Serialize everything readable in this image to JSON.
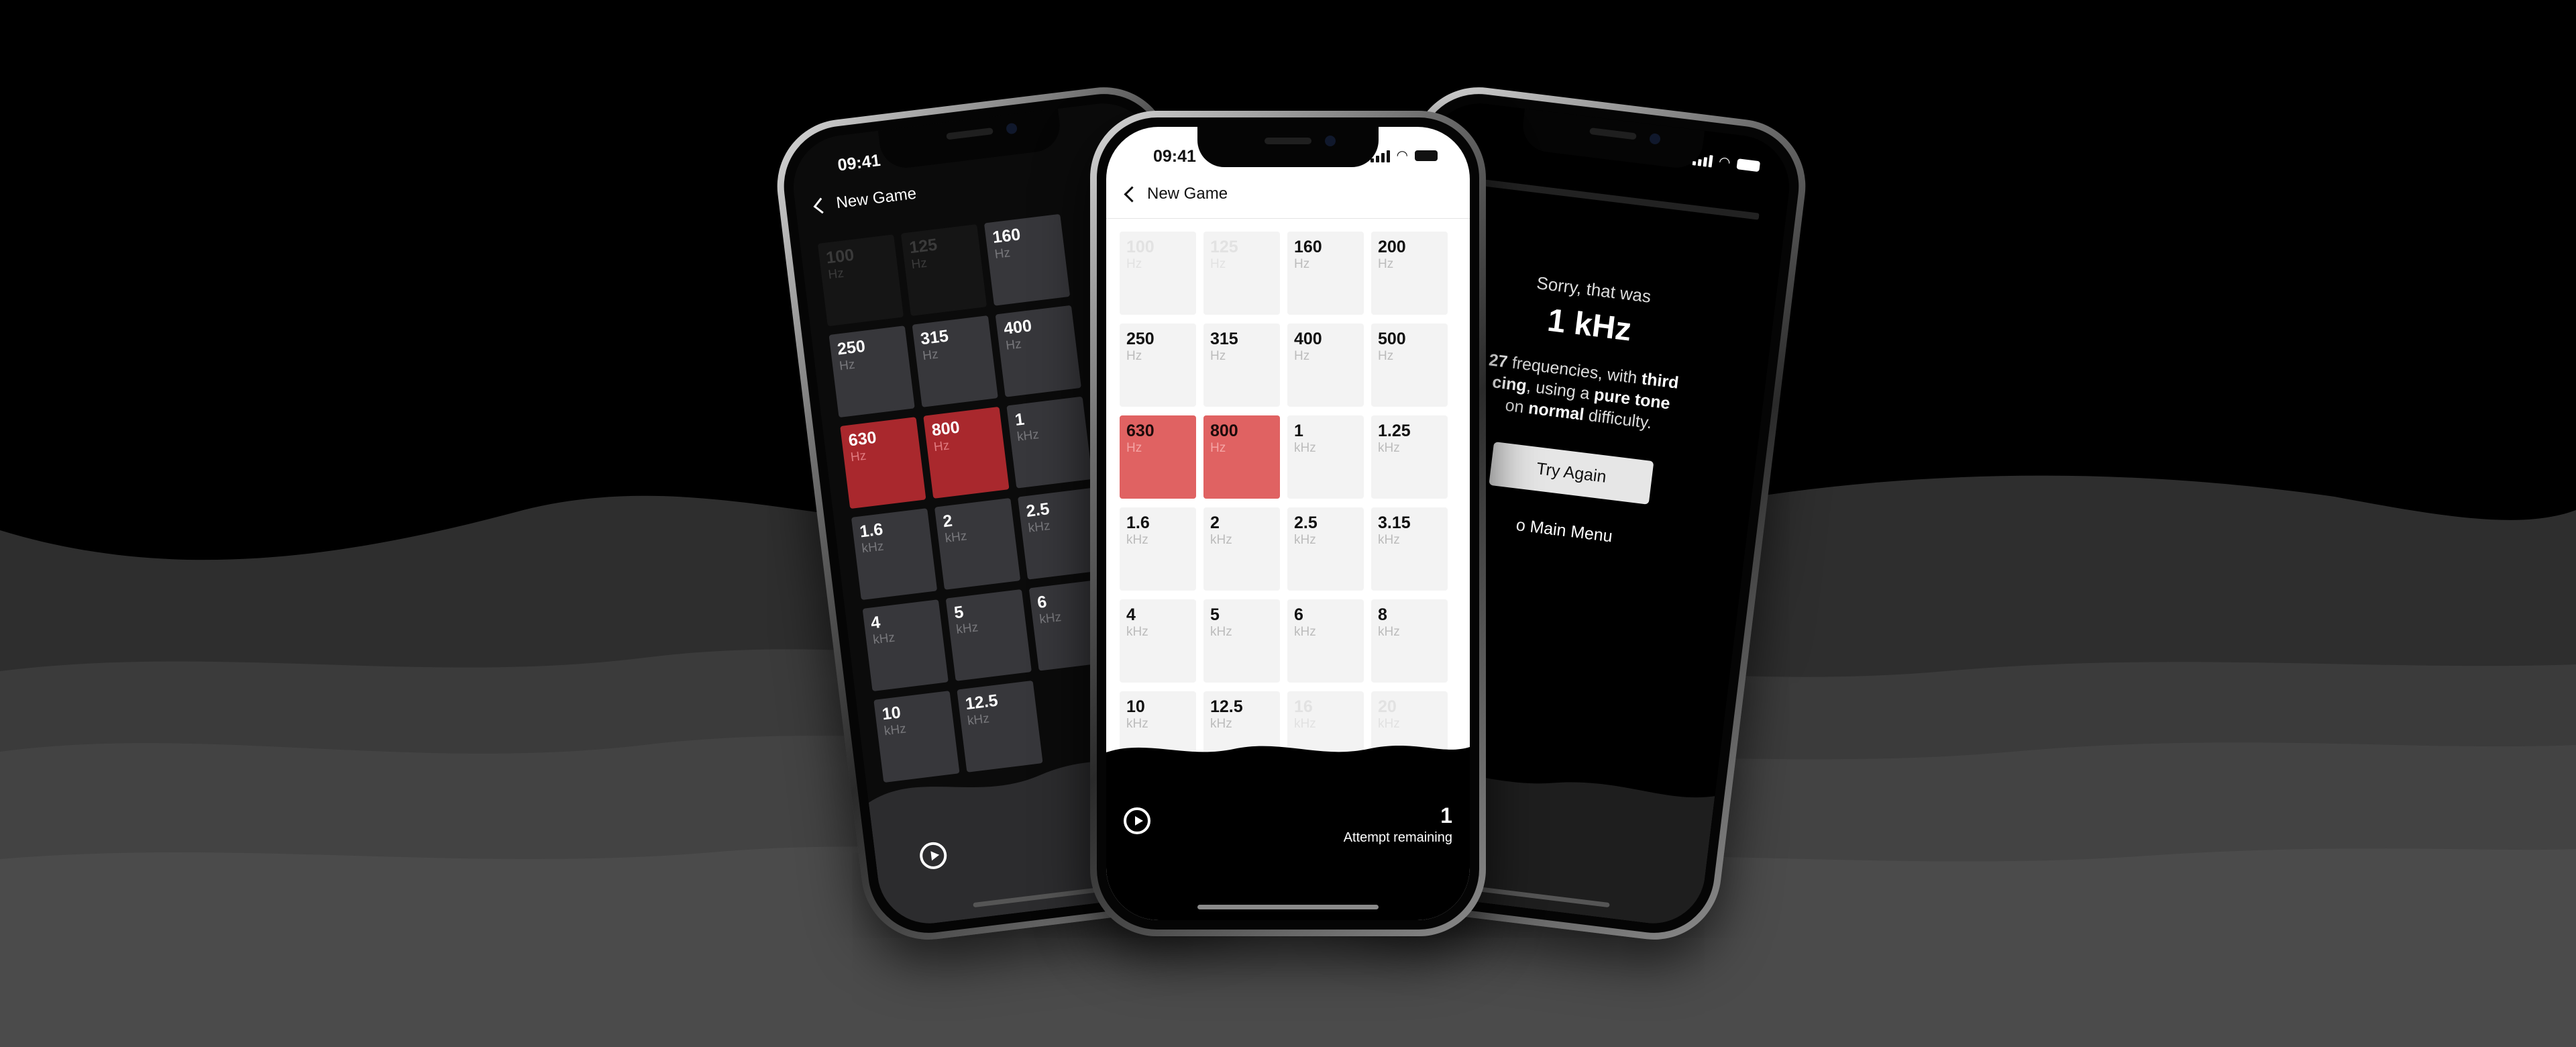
{
  "colors": {
    "bg_top": "#000000",
    "wave1": "#2e2e2e",
    "wave2": "#3e3e3e",
    "wave3": "#4a4a4a",
    "selected_light": "#e06262",
    "selected_dark": "#a9282d"
  },
  "status": {
    "time": "09:41"
  },
  "nav": {
    "back_label": "New Game"
  },
  "center_tiles": [
    {
      "v": "100",
      "u": "Hz",
      "state": "dim"
    },
    {
      "v": "125",
      "u": "Hz",
      "state": "dim"
    },
    {
      "v": "160",
      "u": "Hz",
      "state": "on"
    },
    {
      "v": "200",
      "u": "Hz",
      "state": "on"
    },
    {
      "v": "250",
      "u": "Hz",
      "state": "on"
    },
    {
      "v": "315",
      "u": "Hz",
      "state": "on"
    },
    {
      "v": "400",
      "u": "Hz",
      "state": "on"
    },
    {
      "v": "500",
      "u": "Hz",
      "state": "on"
    },
    {
      "v": "630",
      "u": "Hz",
      "state": "sel"
    },
    {
      "v": "800",
      "u": "Hz",
      "state": "sel"
    },
    {
      "v": "1",
      "u": "kHz",
      "state": "on"
    },
    {
      "v": "1.25",
      "u": "kHz",
      "state": "on"
    },
    {
      "v": "1.6",
      "u": "kHz",
      "state": "on"
    },
    {
      "v": "2",
      "u": "kHz",
      "state": "on"
    },
    {
      "v": "2.5",
      "u": "kHz",
      "state": "on"
    },
    {
      "v": "3.15",
      "u": "kHz",
      "state": "on"
    },
    {
      "v": "4",
      "u": "kHz",
      "state": "on"
    },
    {
      "v": "5",
      "u": "kHz",
      "state": "on"
    },
    {
      "v": "6",
      "u": "kHz",
      "state": "on"
    },
    {
      "v": "8",
      "u": "kHz",
      "state": "on"
    },
    {
      "v": "10",
      "u": "kHz",
      "state": "on"
    },
    {
      "v": "12.5",
      "u": "kHz",
      "state": "on"
    },
    {
      "v": "16",
      "u": "kHz",
      "state": "dim"
    },
    {
      "v": "20",
      "u": "kHz",
      "state": "dim"
    }
  ],
  "left_tiles": [
    {
      "v": "100",
      "u": "Hz",
      "state": "dim"
    },
    {
      "v": "125",
      "u": "Hz",
      "state": "dim"
    },
    {
      "v": "160",
      "u": "Hz",
      "state": "on"
    },
    {
      "v": "",
      "u": "",
      "state": "hidden"
    },
    {
      "v": "250",
      "u": "Hz",
      "state": "on"
    },
    {
      "v": "315",
      "u": "Hz",
      "state": "on"
    },
    {
      "v": "400",
      "u": "Hz",
      "state": "on"
    },
    {
      "v": "",
      "u": "",
      "state": "hidden"
    },
    {
      "v": "630",
      "u": "Hz",
      "state": "sel"
    },
    {
      "v": "800",
      "u": "Hz",
      "state": "sel"
    },
    {
      "v": "1",
      "u": "kHz",
      "state": "on"
    },
    {
      "v": "",
      "u": "",
      "state": "hidden"
    },
    {
      "v": "1.6",
      "u": "kHz",
      "state": "on"
    },
    {
      "v": "2",
      "u": "kHz",
      "state": "on"
    },
    {
      "v": "2.5",
      "u": "kHz",
      "state": "on"
    },
    {
      "v": "",
      "u": "",
      "state": "hidden"
    },
    {
      "v": "4",
      "u": "kHz",
      "state": "on"
    },
    {
      "v": "5",
      "u": "kHz",
      "state": "on"
    },
    {
      "v": "6",
      "u": "kHz",
      "state": "on"
    },
    {
      "v": "",
      "u": "",
      "state": "hidden"
    },
    {
      "v": "10",
      "u": "kHz",
      "state": "on"
    },
    {
      "v": "12.5",
      "u": "kHz",
      "state": "on"
    },
    {
      "v": "",
      "u": "",
      "state": "hidden"
    },
    {
      "v": "",
      "u": "",
      "state": "hidden"
    }
  ],
  "footer": {
    "attempts_count": "1",
    "attempts_label": "Attempt remaining"
  },
  "result": {
    "sorry_text": "Sorry, that was",
    "answer": "1 kHz",
    "detail_1": "27",
    "detail_2": " frequencies, with ",
    "detail_3": "third",
    "detail_4": "cing",
    "detail_5": ", using a ",
    "detail_6": "pure tone",
    "detail_7": "on ",
    "detail_8": "normal",
    "detail_9": " difficulty.",
    "try_again": "Try Again",
    "main_menu": "o Main Menu"
  },
  "icons": [
    "replay-icon",
    "back-chevron-icon",
    "signal-icon",
    "wifi-icon",
    "battery-icon"
  ]
}
